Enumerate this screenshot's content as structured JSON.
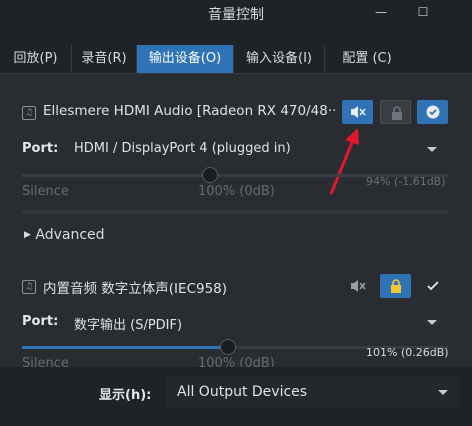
{
  "window": {
    "title": "音量控制",
    "minimize_glyph": "—",
    "restore_glyph": "☐"
  },
  "tabs": [
    {
      "label": "回放(P)"
    },
    {
      "label": "录音(R)"
    },
    {
      "label": "输出设备(O)",
      "active": true
    },
    {
      "label": "输入设备(I)"
    },
    {
      "label": "配置 (C)"
    }
  ],
  "devices": [
    {
      "name": "Ellesmere HDMI Audio [Radeon RX 470/48···",
      "port_label": "Port:",
      "port_value": "HDMI / DisplayPort 4 (plugged in)",
      "slider_left_label": "Silence",
      "slider_mid_label": "100% (0dB)",
      "level_text": "94% (-1.61dB)",
      "volume_fraction": 0.94,
      "mute_icon": "speaker-muted-icon",
      "lock_icon": "lock-icon",
      "default_icon": "check-icon",
      "advanced_label": "Advanced"
    },
    {
      "name": "内置音频 数字立体声(IEC958)",
      "port_label": "Port:",
      "port_value": "数字输出 (S/PDIF)",
      "slider_left_label": "Silence",
      "slider_mid_label": "100% (0dB)",
      "level_text": "101% (0.26dB)",
      "volume_fraction": 1.01,
      "mute_icon": "speaker-muted-icon",
      "lock_icon": "lock-icon",
      "default_icon": "check-icon"
    }
  ],
  "footer": {
    "show_label": "显示(h):",
    "show_value": "All Output Devices"
  },
  "colors": {
    "accent": "#2d73b6",
    "arrow": "#e0192a",
    "lock_gold": "#f2c531"
  }
}
